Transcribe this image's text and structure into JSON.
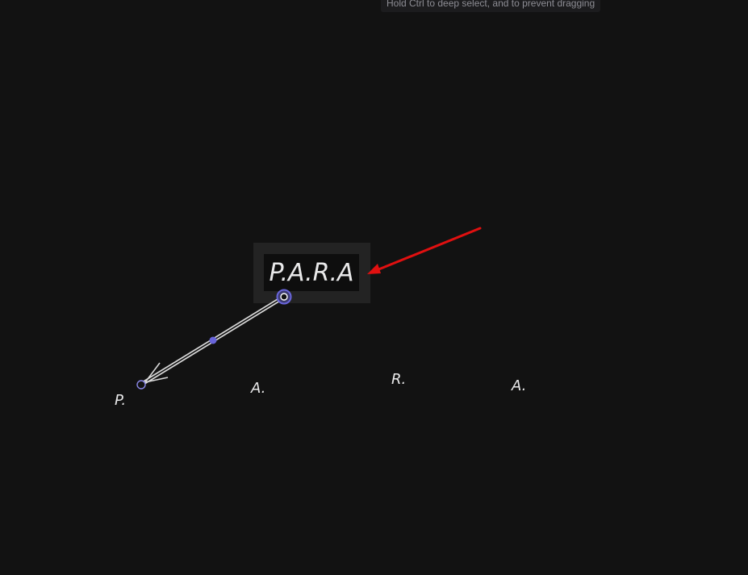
{
  "tooltip": {
    "text": "Hold Ctrl to deep select, and to prevent dragging"
  },
  "canvas": {
    "selected_text": "P.A.R.A",
    "labels": [
      "P.",
      "A.",
      "R.",
      "A."
    ]
  },
  "colors": {
    "background": "#121212",
    "selection": "#6965db",
    "annotation_arrow": "#e01010",
    "ink": "#e9e9ea"
  },
  "icons": [
    "arrow-handle-start-icon",
    "arrow-handle-mid-icon",
    "arrow-handle-end-icon"
  ]
}
